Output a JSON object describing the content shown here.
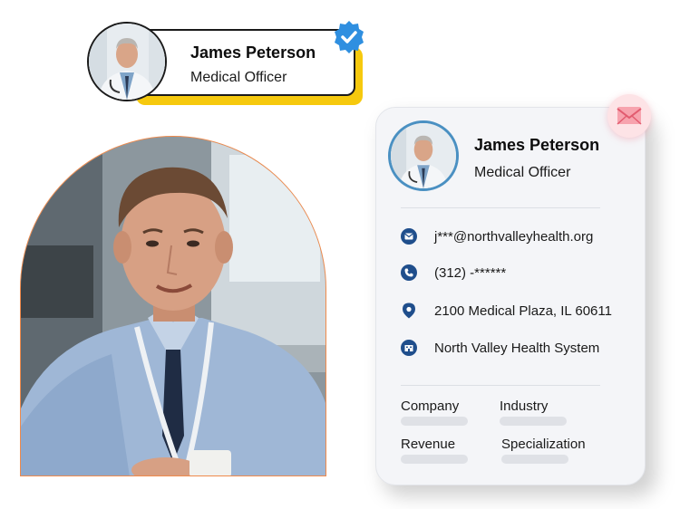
{
  "mini_card": {
    "name": "James Peterson",
    "title": "Medical Officer",
    "verified_icon": "verified-check-icon"
  },
  "profile_card": {
    "name": "James Peterson",
    "title": "Medical Officer",
    "badge_icon": "envelope-icon",
    "contacts": [
      {
        "icon": "email-icon",
        "text": "j***@northvalleyhealth.org"
      },
      {
        "icon": "phone-icon",
        "text": "(312) -******"
      },
      {
        "icon": "location-pin-icon",
        "text": "2100 Medical Plaza, IL 60611"
      },
      {
        "icon": "organization-icon",
        "text": "North Valley Health System"
      }
    ],
    "fields": [
      "Company",
      "Industry",
      "Revenue",
      "Specialization"
    ]
  },
  "colors": {
    "accent_yellow": "#f6c90e",
    "icon_navy": "#1f4e8c",
    "verified_blue": "#2f8fe0",
    "arch_border": "#f08a4b"
  }
}
